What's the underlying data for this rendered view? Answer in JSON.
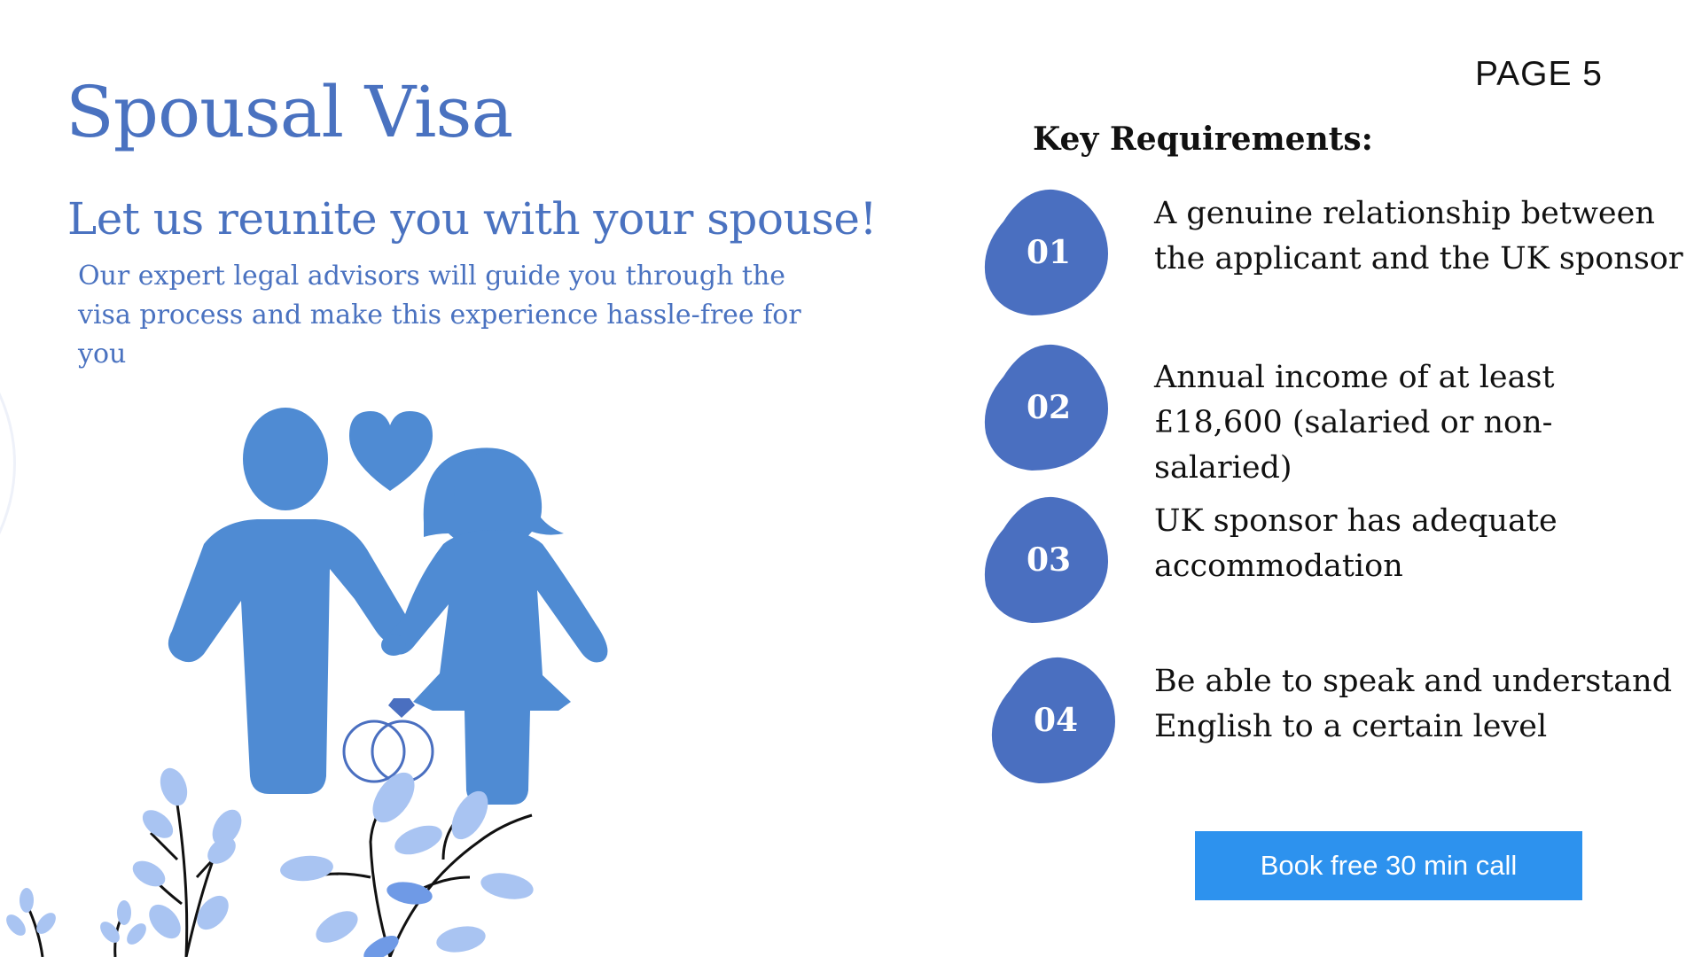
{
  "page": {
    "number_label": "PAGE 5",
    "title": "Spousal Visa",
    "subtitle": "Let us reunite you with your spouse!",
    "intro": "Our expert legal advisors will guide you through the visa process and make this experience hassle-free for you"
  },
  "requirements": {
    "heading": "Key Requirements:",
    "items": [
      {
        "number": "01",
        "text": "A genuine relationship between  the applicant and the UK sponsor"
      },
      {
        "number": "02",
        "text": " Annual income of at least £18,600 (salaried or non-salaried)"
      },
      {
        "number": "03",
        "text": "UK sponsor has adequate accommodation"
      },
      {
        "number": "04",
        "text": "Be able to speak and understand English to a certain level"
      }
    ]
  },
  "cta": {
    "label": "Book free 30 min call"
  },
  "icons": {
    "illustration": "couple-holding-hands-icon",
    "heart": "heart-icon",
    "rings": "wedding-rings-icon",
    "foliage": "leaf-branch-icon"
  },
  "colors": {
    "title": "#4a72c0",
    "figure": "#4f8bd3",
    "badge": "#4a6fc0",
    "button": "#2d92ee",
    "leaf_light": "#a9c4f2",
    "leaf_mid": "#6f9ae6",
    "text": "#111111"
  }
}
